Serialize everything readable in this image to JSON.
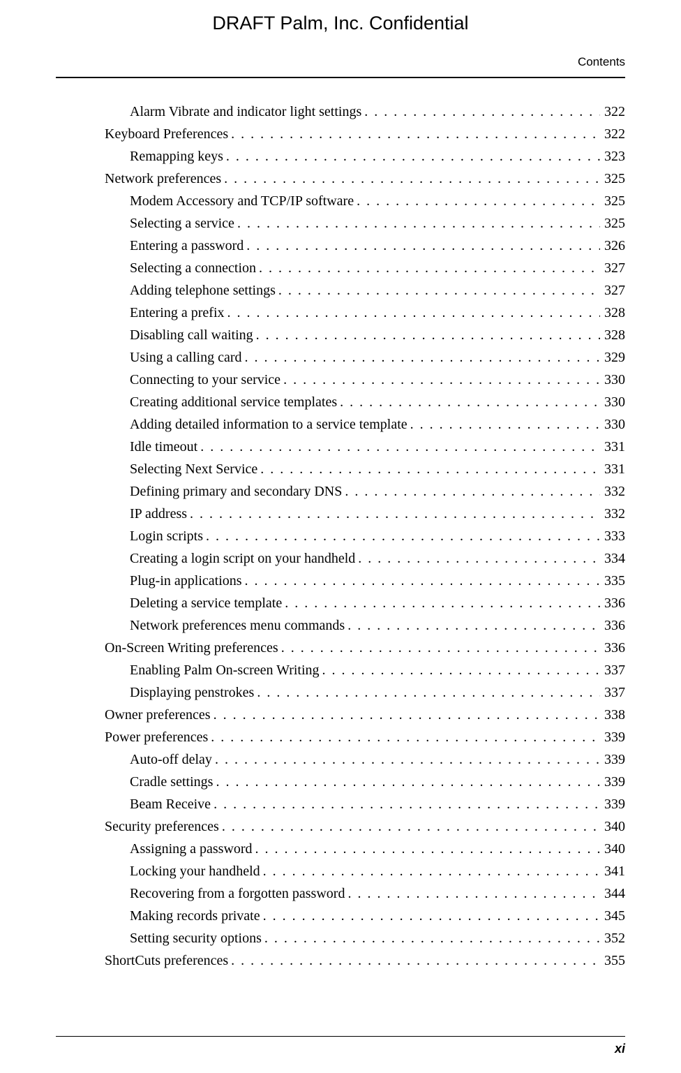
{
  "header": {
    "draft_line": "DRAFT   Palm, Inc. Confidential",
    "section": "Contents"
  },
  "toc": [
    {
      "level": 2,
      "title": "Alarm Vibrate and indicator light settings",
      "page": "322"
    },
    {
      "level": 1,
      "title": "Keyboard Preferences",
      "page": "322"
    },
    {
      "level": 2,
      "title": "Remapping keys",
      "page": "323"
    },
    {
      "level": 1,
      "title": "Network preferences",
      "page": "325"
    },
    {
      "level": 2,
      "title": "Modem Accessory and TCP/IP software",
      "page": "325"
    },
    {
      "level": 2,
      "title": "Selecting a service",
      "page": "325"
    },
    {
      "level": 2,
      "title": "Entering a password",
      "page": "326"
    },
    {
      "level": 2,
      "title": "Selecting a connection",
      "page": "327"
    },
    {
      "level": 2,
      "title": "Adding telephone settings",
      "page": "327"
    },
    {
      "level": 2,
      "title": "Entering a prefix",
      "page": "328"
    },
    {
      "level": 2,
      "title": "Disabling call waiting",
      "page": "328"
    },
    {
      "level": 2,
      "title": "Using a calling card",
      "page": "329"
    },
    {
      "level": 2,
      "title": "Connecting to your service",
      "page": "330"
    },
    {
      "level": 2,
      "title": "Creating additional service templates",
      "page": "330"
    },
    {
      "level": 2,
      "title": "Adding detailed information to a service template",
      "page": "330"
    },
    {
      "level": 2,
      "title": "Idle timeout",
      "page": "331"
    },
    {
      "level": 2,
      "title": "Selecting Next Service",
      "page": "331"
    },
    {
      "level": 2,
      "title": "Defining primary and secondary DNS",
      "page": "332"
    },
    {
      "level": 2,
      "title": "IP address",
      "page": "332"
    },
    {
      "level": 2,
      "title": "Login scripts",
      "page": "333"
    },
    {
      "level": 2,
      "title": "Creating a login script on your handheld",
      "page": "334"
    },
    {
      "level": 2,
      "title": "Plug-in applications",
      "page": "335"
    },
    {
      "level": 2,
      "title": "Deleting a service template",
      "page": "336"
    },
    {
      "level": 2,
      "title": "Network preferences menu commands",
      "page": "336"
    },
    {
      "level": 1,
      "title": "On-Screen Writing preferences",
      "page": "336"
    },
    {
      "level": 2,
      "title": "Enabling Palm On-screen Writing",
      "page": "337"
    },
    {
      "level": 2,
      "title": "Displaying penstrokes",
      "page": "337"
    },
    {
      "level": 1,
      "title": "Owner preferences",
      "page": "338"
    },
    {
      "level": 1,
      "title": "Power preferences",
      "page": "339"
    },
    {
      "level": 2,
      "title": "Auto-off delay",
      "page": "339"
    },
    {
      "level": 2,
      "title": "Cradle settings",
      "page": "339"
    },
    {
      "level": 2,
      "title": "Beam Receive",
      "page": "339"
    },
    {
      "level": 1,
      "title": "Security preferences",
      "page": "340"
    },
    {
      "level": 2,
      "title": "Assigning a password",
      "page": "340"
    },
    {
      "level": 2,
      "title": "Locking your handheld",
      "page": "341"
    },
    {
      "level": 2,
      "title": "Recovering from a forgotten password",
      "page": "344"
    },
    {
      "level": 2,
      "title": "Making records private",
      "page": "345"
    },
    {
      "level": 2,
      "title": "Setting security options",
      "page": "352"
    },
    {
      "level": 1,
      "title": "ShortCuts preferences",
      "page": "355"
    }
  ],
  "footer": {
    "page_number": "xi"
  }
}
